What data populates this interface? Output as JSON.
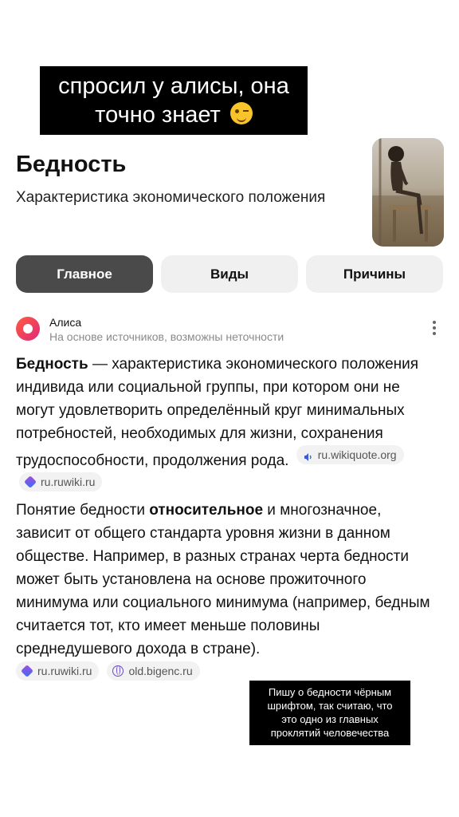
{
  "story_caption": {
    "lines": [
      "спросил у алисы, она",
      "точно знает"
    ],
    "emoji": "winking-face-icon"
  },
  "entity": {
    "title": "Бедность",
    "subtitle": "Характеристика экономического положения",
    "image": "boy-on-stool-photo"
  },
  "tabs": [
    {
      "label": "Главное",
      "active": true
    },
    {
      "label": "Виды",
      "active": false
    },
    {
      "label": "Причины",
      "active": false
    }
  ],
  "alice": {
    "name": "Алиса",
    "note": "На основе источников, возможны неточности",
    "menu_icon": "more-vertical-icon"
  },
  "answer": {
    "p1_bold": "Бедность",
    "p1_text": " — характеристика экономического положения индивида или социальной группы, при котором они не могут удовлетворить определённый круг минимальных потребностей, необходимых для жизни, сохранения трудоспособности, продолжения рода.",
    "p1_sources": [
      "ru.wikiquote.org",
      "ru.ruwiki.ru"
    ],
    "p2_before": "Понятие бедности ",
    "p2_bold": "относительное",
    "p2_after": " и многозначное, зависит от общего стандарта уровня жизни в данном обществе. Например, в разных странах черта бедности может быть установлена на основе прожиточного минимума или социального минимума (например, бедным считается тот, кто имеет меньше половины среднедушевого дохода в стране).",
    "p2_sources": [
      "ru.ruwiki.ru",
      "old.bigenc.ru"
    ]
  },
  "overlay_note": {
    "lines": [
      "Пишу о бедности чёрным",
      "шрифтом, так считаю, что",
      "это одно из главных",
      "проклятий человечества"
    ]
  },
  "colors": {
    "active_tab": "#4a4a4a",
    "inactive_tab": "#f0f0f0",
    "alice_brand": "#ff5a3d",
    "caption_bg": "#000000"
  }
}
